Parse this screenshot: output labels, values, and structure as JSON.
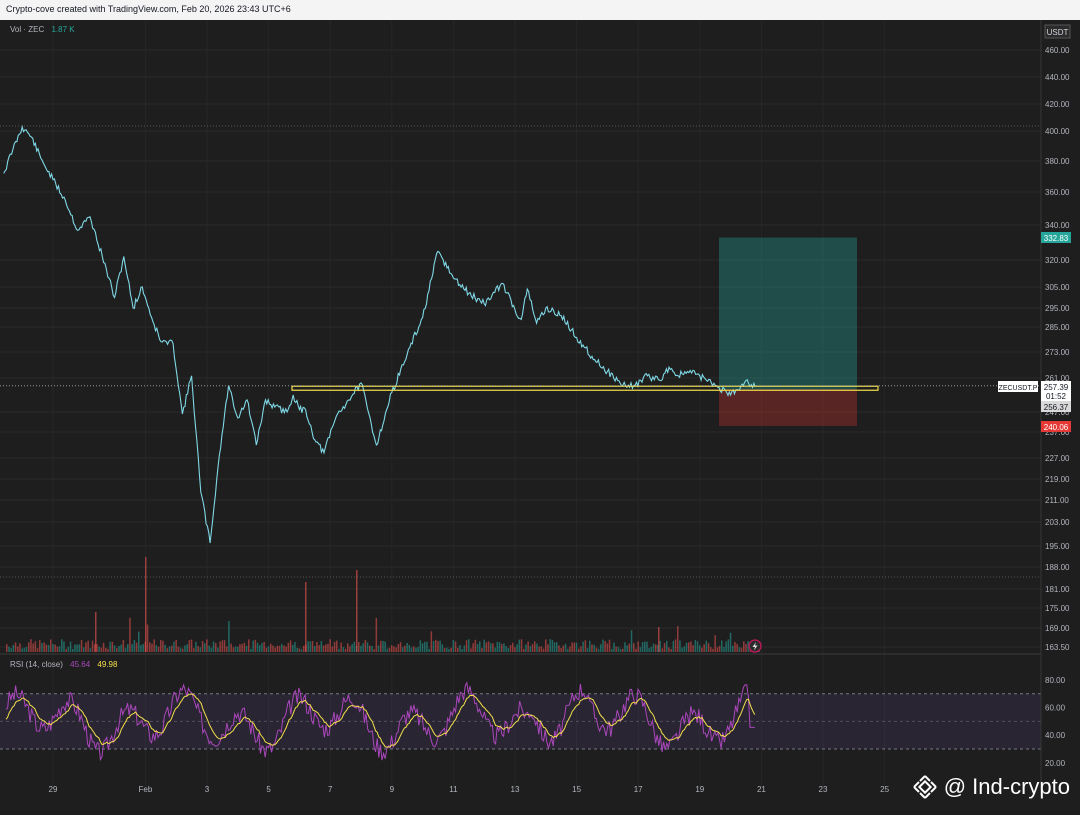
{
  "header": {
    "text": "Crypto-cove created with TradingView.com, Feb 20, 2026 23:43 UTC+6"
  },
  "volume_label": {
    "name": "Vol · ZEC",
    "value": "1.87 K"
  },
  "rsi_label": {
    "name": "RSI (14, close)",
    "value1": "45.64",
    "value2": "49.98"
  },
  "watermark": {
    "text": "@ Ind-crypto"
  },
  "chart_data": [
    {
      "type": "line",
      "title": "",
      "currency": "USDT",
      "symbol": "ZECUSDT.P",
      "price_scale_ticks": [
        "460.00",
        "440.00",
        "420.00",
        "400.00",
        "380.00",
        "360.00",
        "340.00",
        "320.00",
        "305.00",
        "295.00",
        "285.00",
        "273.00",
        "261.00",
        "247.00",
        "237.00",
        "227.00",
        "219.00",
        "211.00",
        "203.00",
        "195.00",
        "188.00",
        "181.00",
        "175.00",
        "169.00",
        "163.50"
      ],
      "time_ticks": [
        "29",
        "Feb",
        "3",
        "5",
        "7",
        "9",
        "11",
        "13",
        "15",
        "17",
        "19",
        "21",
        "23",
        "25"
      ],
      "labels": {
        "current_price": "257.39",
        "countdown": "01:52",
        "level": "256.37",
        "take_profit": "332.83",
        "stop_loss": "240.06"
      },
      "support_level": 256.37,
      "position": {
        "entry": 256.37,
        "take_profit": 332.83,
        "stop_loss": 240.06
      },
      "series": [
        {
          "x": [
            27.4,
            27.7,
            28.0,
            28.3,
            28.6,
            29.0,
            29.4,
            29.8,
            30.2,
            30.6,
            31.0,
            31.3,
            31.6,
            31.9,
            32.2,
            32.5,
            32.9,
            33.2,
            33.5,
            33.8,
            34.1,
            34.4,
            34.7,
            35.0,
            35.3,
            35.6,
            35.9,
            36.2,
            36.6,
            36.8,
            37.0,
            37.2,
            37.5,
            37.8,
            38.2,
            38.6,
            39.0,
            39.5,
            40.0,
            40.5,
            41.0,
            41.5,
            42.0,
            42.5,
            43.0,
            43.6,
            44.0,
            44.2,
            44.4,
            44.7,
            45.0,
            45.5,
            46.0,
            46.5,
            47.0,
            47.5,
            47.9,
            48.3,
            48.7,
            49.0,
            49.3,
            49.6,
            50.0,
            50.5,
            51.0,
            51.5,
            51.8
          ],
          "values": [
            372,
            388,
            403,
            396,
            382,
            368,
            355,
            337,
            345,
            322,
            300,
            322,
            295,
            305,
            290,
            278,
            277,
            246,
            262,
            214,
            196,
            228,
            258,
            244,
            252,
            232,
            252,
            249,
            247,
            254,
            248,
            248,
            234,
            229,
            245,
            252,
            259,
            232,
            255,
            272,
            290,
            325,
            310,
            302,
            297,
            307,
            294,
            289,
            304,
            287,
            295,
            291,
            280,
            271,
            264,
            258,
            258,
            262,
            260,
            266,
            262,
            264,
            262,
            258,
            254,
            260,
            257.4
          ]
        }
      ],
      "volume": {
        "name": "Vol · ZEC",
        "last": "1.87 K"
      },
      "rsi": {
        "name": "RSI (14, close)",
        "value": 45.64,
        "ma": 49.98,
        "ticks": [
          "80.00",
          "60.00",
          "40.00",
          "20.00"
        ],
        "bands": [
          30,
          70
        ]
      }
    }
  ]
}
